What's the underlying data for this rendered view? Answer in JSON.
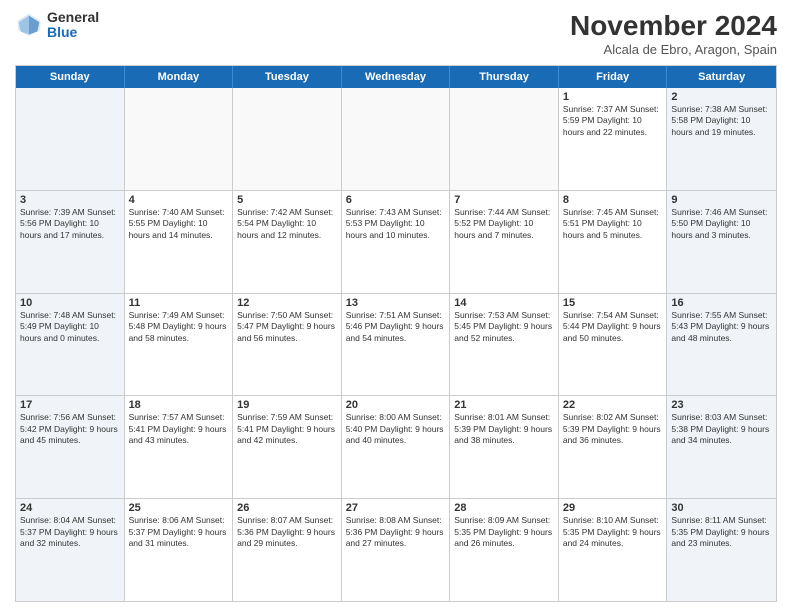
{
  "logo": {
    "general": "General",
    "blue": "Blue"
  },
  "title": "November 2024",
  "location": "Alcala de Ebro, Aragon, Spain",
  "dayHeaders": [
    "Sunday",
    "Monday",
    "Tuesday",
    "Wednesday",
    "Thursday",
    "Friday",
    "Saturday"
  ],
  "weeks": [
    [
      {
        "day": "",
        "info": ""
      },
      {
        "day": "",
        "info": ""
      },
      {
        "day": "",
        "info": ""
      },
      {
        "day": "",
        "info": ""
      },
      {
        "day": "",
        "info": ""
      },
      {
        "day": "1",
        "info": "Sunrise: 7:37 AM\nSunset: 5:59 PM\nDaylight: 10 hours and 22 minutes."
      },
      {
        "day": "2",
        "info": "Sunrise: 7:38 AM\nSunset: 5:58 PM\nDaylight: 10 hours and 19 minutes."
      }
    ],
    [
      {
        "day": "3",
        "info": "Sunrise: 7:39 AM\nSunset: 5:56 PM\nDaylight: 10 hours and 17 minutes."
      },
      {
        "day": "4",
        "info": "Sunrise: 7:40 AM\nSunset: 5:55 PM\nDaylight: 10 hours and 14 minutes."
      },
      {
        "day": "5",
        "info": "Sunrise: 7:42 AM\nSunset: 5:54 PM\nDaylight: 10 hours and 12 minutes."
      },
      {
        "day": "6",
        "info": "Sunrise: 7:43 AM\nSunset: 5:53 PM\nDaylight: 10 hours and 10 minutes."
      },
      {
        "day": "7",
        "info": "Sunrise: 7:44 AM\nSunset: 5:52 PM\nDaylight: 10 hours and 7 minutes."
      },
      {
        "day": "8",
        "info": "Sunrise: 7:45 AM\nSunset: 5:51 PM\nDaylight: 10 hours and 5 minutes."
      },
      {
        "day": "9",
        "info": "Sunrise: 7:46 AM\nSunset: 5:50 PM\nDaylight: 10 hours and 3 minutes."
      }
    ],
    [
      {
        "day": "10",
        "info": "Sunrise: 7:48 AM\nSunset: 5:49 PM\nDaylight: 10 hours and 0 minutes."
      },
      {
        "day": "11",
        "info": "Sunrise: 7:49 AM\nSunset: 5:48 PM\nDaylight: 9 hours and 58 minutes."
      },
      {
        "day": "12",
        "info": "Sunrise: 7:50 AM\nSunset: 5:47 PM\nDaylight: 9 hours and 56 minutes."
      },
      {
        "day": "13",
        "info": "Sunrise: 7:51 AM\nSunset: 5:46 PM\nDaylight: 9 hours and 54 minutes."
      },
      {
        "day": "14",
        "info": "Sunrise: 7:53 AM\nSunset: 5:45 PM\nDaylight: 9 hours and 52 minutes."
      },
      {
        "day": "15",
        "info": "Sunrise: 7:54 AM\nSunset: 5:44 PM\nDaylight: 9 hours and 50 minutes."
      },
      {
        "day": "16",
        "info": "Sunrise: 7:55 AM\nSunset: 5:43 PM\nDaylight: 9 hours and 48 minutes."
      }
    ],
    [
      {
        "day": "17",
        "info": "Sunrise: 7:56 AM\nSunset: 5:42 PM\nDaylight: 9 hours and 45 minutes."
      },
      {
        "day": "18",
        "info": "Sunrise: 7:57 AM\nSunset: 5:41 PM\nDaylight: 9 hours and 43 minutes."
      },
      {
        "day": "19",
        "info": "Sunrise: 7:59 AM\nSunset: 5:41 PM\nDaylight: 9 hours and 42 minutes."
      },
      {
        "day": "20",
        "info": "Sunrise: 8:00 AM\nSunset: 5:40 PM\nDaylight: 9 hours and 40 minutes."
      },
      {
        "day": "21",
        "info": "Sunrise: 8:01 AM\nSunset: 5:39 PM\nDaylight: 9 hours and 38 minutes."
      },
      {
        "day": "22",
        "info": "Sunrise: 8:02 AM\nSunset: 5:39 PM\nDaylight: 9 hours and 36 minutes."
      },
      {
        "day": "23",
        "info": "Sunrise: 8:03 AM\nSunset: 5:38 PM\nDaylight: 9 hours and 34 minutes."
      }
    ],
    [
      {
        "day": "24",
        "info": "Sunrise: 8:04 AM\nSunset: 5:37 PM\nDaylight: 9 hours and 32 minutes."
      },
      {
        "day": "25",
        "info": "Sunrise: 8:06 AM\nSunset: 5:37 PM\nDaylight: 9 hours and 31 minutes."
      },
      {
        "day": "26",
        "info": "Sunrise: 8:07 AM\nSunset: 5:36 PM\nDaylight: 9 hours and 29 minutes."
      },
      {
        "day": "27",
        "info": "Sunrise: 8:08 AM\nSunset: 5:36 PM\nDaylight: 9 hours and 27 minutes."
      },
      {
        "day": "28",
        "info": "Sunrise: 8:09 AM\nSunset: 5:35 PM\nDaylight: 9 hours and 26 minutes."
      },
      {
        "day": "29",
        "info": "Sunrise: 8:10 AM\nSunset: 5:35 PM\nDaylight: 9 hours and 24 minutes."
      },
      {
        "day": "30",
        "info": "Sunrise: 8:11 AM\nSunset: 5:35 PM\nDaylight: 9 hours and 23 minutes."
      }
    ]
  ]
}
